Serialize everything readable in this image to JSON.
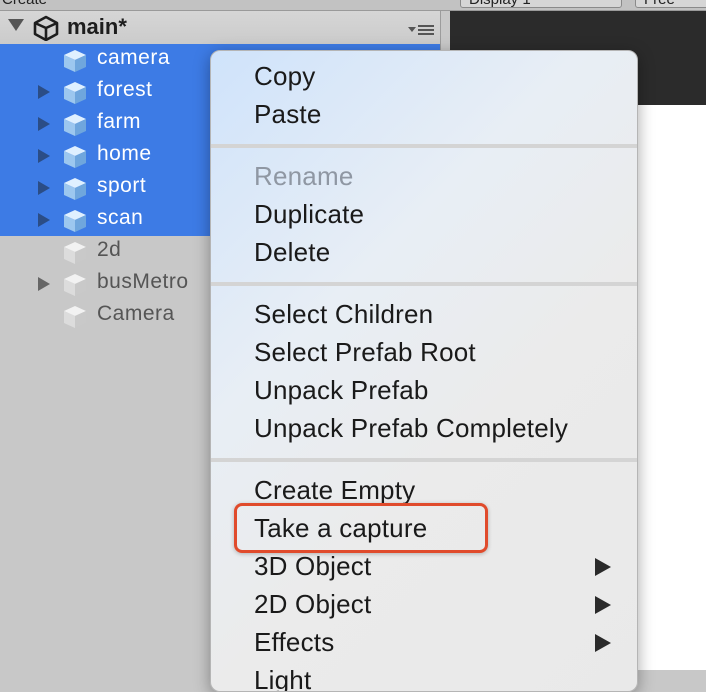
{
  "topbar": {
    "left_label": "Create",
    "display_label": "Display 1",
    "right_label": "Free Aspect"
  },
  "hierarchy": {
    "scene_title": "main*",
    "items": [
      {
        "name": "camera",
        "selected": true,
        "expandable": false
      },
      {
        "name": "forest",
        "selected": true,
        "expandable": true
      },
      {
        "name": "farm",
        "selected": true,
        "expandable": true
      },
      {
        "name": "home",
        "selected": true,
        "expandable": true
      },
      {
        "name": "sport",
        "selected": true,
        "expandable": true
      },
      {
        "name": "scan",
        "selected": true,
        "expandable": true
      },
      {
        "name": "2d",
        "selected": false,
        "expandable": false
      },
      {
        "name": "busMetro",
        "selected": false,
        "expandable": true
      },
      {
        "name": "Camera",
        "selected": false,
        "expandable": false
      }
    ]
  },
  "context_menu": {
    "copy": "Copy",
    "paste": "Paste",
    "rename": "Rename",
    "duplicate": "Duplicate",
    "delete": "Delete",
    "select_children": "Select Children",
    "select_prefab_root": "Select Prefab Root",
    "unpack_prefab": "Unpack Prefab",
    "unpack_prefab_completely": "Unpack Prefab Completely",
    "create_empty": "Create Empty",
    "take_a_capture": "Take a capture",
    "object_3d": "3D Object",
    "object_2d": "2D Object",
    "effects": "Effects",
    "light": "Light"
  },
  "colors": {
    "selection": "#3d7be5",
    "highlight_border": "#e04b2c"
  }
}
